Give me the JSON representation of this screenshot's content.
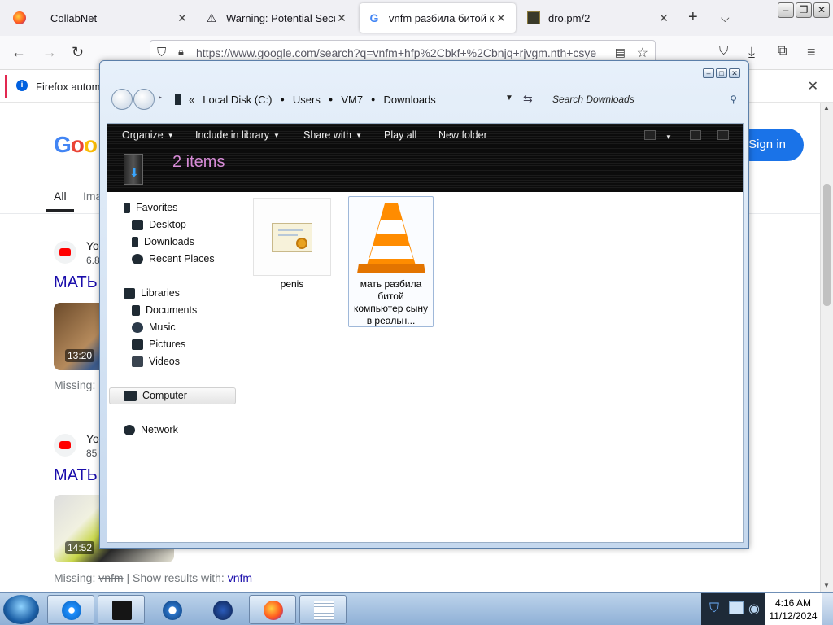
{
  "browser": {
    "tabs": [
      {
        "title": "CollabNet",
        "icon": "firefox-icon"
      },
      {
        "title": "Warning: Potential Securi",
        "icon": "warning-icon"
      },
      {
        "title": "vnfm разбила битой ком",
        "icon": "google-icon",
        "active": true
      },
      {
        "title": "dro.pm/2",
        "icon": "dro-icon"
      }
    ],
    "url": "https://www.google.com/search?q=vnfm+hfp%2Cbkf+%2Cbnjq+rjvgm.nth+csye",
    "notification": "Firefox automa",
    "notification_info": "i"
  },
  "google": {
    "logo": "Goo",
    "sign_in": "Sign in",
    "tab_all": "All",
    "tab_images": "Ima",
    "results": [
      {
        "source": "Yo",
        "sub": "6.8",
        "title": "МАТЬ",
        "duration": "13:20",
        "missing_prefix": "Missing: "
      },
      {
        "source": "Yo",
        "sub": "85",
        "title": "МАТЬ",
        "duration": "14:52",
        "missing_prefix": "Missing: ",
        "missing_word": "vnfm",
        "show_results": " | Show results with: ",
        "show_link": "vnfm"
      }
    ]
  },
  "explorer": {
    "breadcrumb": [
      "Local Disk (C:)",
      "Users",
      "VM7",
      "Downloads"
    ],
    "breadcrumb_prefix": "«",
    "search_placeholder": "Search Downloads",
    "toolbar": {
      "organize": "Organize",
      "include": "Include in library",
      "share": "Share with",
      "play": "Play all",
      "new_folder": "New folder"
    },
    "item_count": "2 items",
    "nav": {
      "favorites": "Favorites",
      "desktop": "Desktop",
      "downloads": "Downloads",
      "recent": "Recent Places",
      "libraries": "Libraries",
      "documents": "Documents",
      "music": "Music",
      "pictures": "Pictures",
      "videos": "Videos",
      "computer": "Computer",
      "network": "Network"
    },
    "files": [
      {
        "name": "penis",
        "icon": "certificate-icon"
      },
      {
        "name": "мать разбила битой компьютер сыну в реальн...",
        "icon": "vlc-icon"
      }
    ]
  },
  "taskbar": {
    "apps": [
      "internet-explorer-icon",
      "explorer-icon",
      "media-player-icon",
      "network-globe-icon",
      "firefox-icon",
      "notepad-icon"
    ],
    "time": "4:16 AM",
    "date": "11/12/2024"
  }
}
